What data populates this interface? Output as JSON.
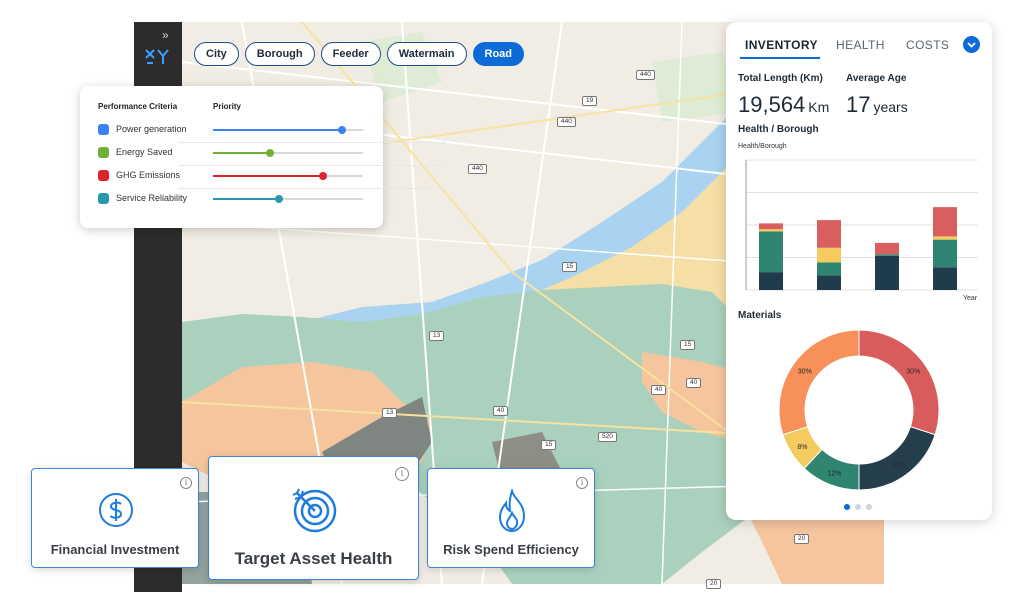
{
  "filters": [
    {
      "label": "City",
      "active": false
    },
    {
      "label": "Borough",
      "active": false
    },
    {
      "label": "Feeder",
      "active": false
    },
    {
      "label": "Watermain",
      "active": false
    },
    {
      "label": "Road",
      "active": true
    }
  ],
  "performance": {
    "col_criteria": "Performance Criteria",
    "col_priority": "Priority",
    "items": [
      {
        "label": "Power generation",
        "color": "#3b82f6",
        "value": 0.86
      },
      {
        "label": "Energy Saved",
        "color": "#6fb136",
        "value": 0.38
      },
      {
        "label": "GHG Emissions",
        "color": "#d9262b",
        "value": 0.73
      },
      {
        "label": "Service Reliability",
        "color": "#2a97b0",
        "value": 0.44
      }
    ]
  },
  "panel": {
    "tabs": [
      "INVENTORY",
      "HEALTH",
      "COSTS"
    ],
    "active_tab": "INVENTORY",
    "kpis": [
      {
        "label": "Total Length (Km)",
        "value": "19,564",
        "unit": "Km"
      },
      {
        "label": "Average Age",
        "value": "17",
        "unit": "years"
      }
    ],
    "health_title": "Health / Borough",
    "materials_title": "Materials",
    "pagination": {
      "count": 3,
      "active": 0
    }
  },
  "chart_data": [
    {
      "type": "bar",
      "title": "Health/Borough",
      "xlabel": "Year",
      "ylabel": "",
      "stacked": true,
      "ylim": [
        0,
        4
      ],
      "grid": true,
      "categories": [
        "",
        "",
        "",
        ""
      ],
      "colors": [
        "#1f3c4d",
        "#2f8472",
        "#f3cb5e",
        "#d95f5f"
      ],
      "series": [
        {
          "values": [
            0.55,
            0.45,
            1.05,
            0.7
          ]
        },
        {
          "values": [
            1.25,
            0.4,
            0.05,
            0.85
          ]
        },
        {
          "values": [
            0.07,
            0.45,
            0,
            0.1
          ]
        },
        {
          "values": [
            0.18,
            0.85,
            0.35,
            0.9
          ]
        }
      ]
    },
    {
      "type": "pie",
      "title": "",
      "values": [
        30,
        20,
        12,
        8,
        30
      ],
      "labels": [
        "30%",
        "20%",
        "12%",
        "8%",
        "30%"
      ],
      "colors": [
        "#d95c5c",
        "#253e4b",
        "#2f8472",
        "#f3cb5e",
        "#f7905a"
      ]
    }
  ],
  "cards": [
    {
      "title": "Financial Investment",
      "icon": "dollar-icon"
    },
    {
      "title": "Target Asset Health",
      "icon": "target-icon"
    },
    {
      "title": "Risk Spend Efficiency",
      "icon": "flame-icon"
    }
  ],
  "map": {
    "road_labels": [
      "440",
      "19",
      "440",
      "440",
      "15",
      "13",
      "15",
      "40",
      "40",
      "15",
      "520",
      "13",
      "40",
      "20",
      "20",
      "15",
      "13"
    ]
  }
}
